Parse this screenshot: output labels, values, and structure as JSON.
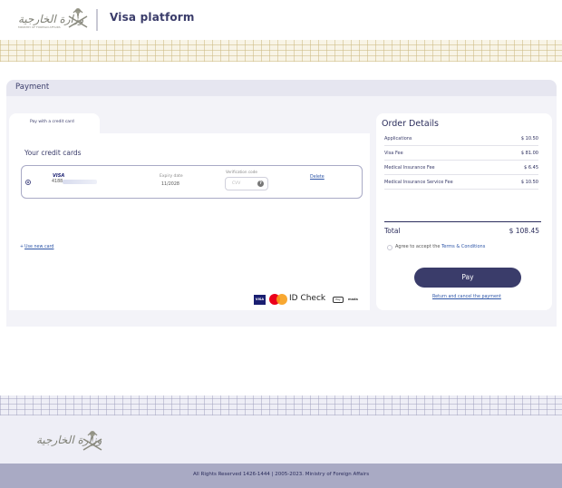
{
  "header": {
    "logo_text": "وزارة الخارجية",
    "logo_subtext": "MINISTRY OF FOREIGN AFFAIRS",
    "platform_title": "Visa platform"
  },
  "payment": {
    "section_title": "Payment",
    "tab_label": "Pay with a credit card",
    "cards_title": "Your credit cards",
    "card": {
      "brand": "VISA",
      "number_prefix": "4188",
      "expiry_label": "Expiry date",
      "expiry_value": "11/2028",
      "verification_label": "Verification code",
      "cvv_placeholder": "CVV",
      "cvv_help": "?",
      "delete_label": "Delete"
    },
    "new_card_label": "Use new card",
    "new_card_icon": "+",
    "logos": {
      "visa": "VISA",
      "id_check": "ID Check",
      "apple_pay": "Pay",
      "mada": "mada"
    }
  },
  "order": {
    "title": "Order Details",
    "fees": [
      {
        "name": "Applications",
        "value": "$ 10.50"
      },
      {
        "name": "Visa Fee",
        "value": "$ 81.00"
      },
      {
        "name": "Medical Insurance Fee",
        "value": "$ 6.45"
      },
      {
        "name": "Medical Insurance Service Fee",
        "value": "$ 10.50"
      }
    ],
    "total_label": "Total",
    "total_value": "$ 108.45",
    "agree_prefix": "Agree to accept the",
    "agree_link": "Terms & Conditions",
    "pay_label": "Pay",
    "cancel_label": "Return and cancel the payment"
  },
  "footer": {
    "logo_text": "وزارة الخارجية",
    "copyright": "All Rights Reserved 1426-1444 | 2005-2023. Ministry of Foreign Affairs"
  },
  "colors": {
    "primary": "#3a3c6a",
    "link": "#2e56a8",
    "footer_bar": "#a9aac4"
  }
}
